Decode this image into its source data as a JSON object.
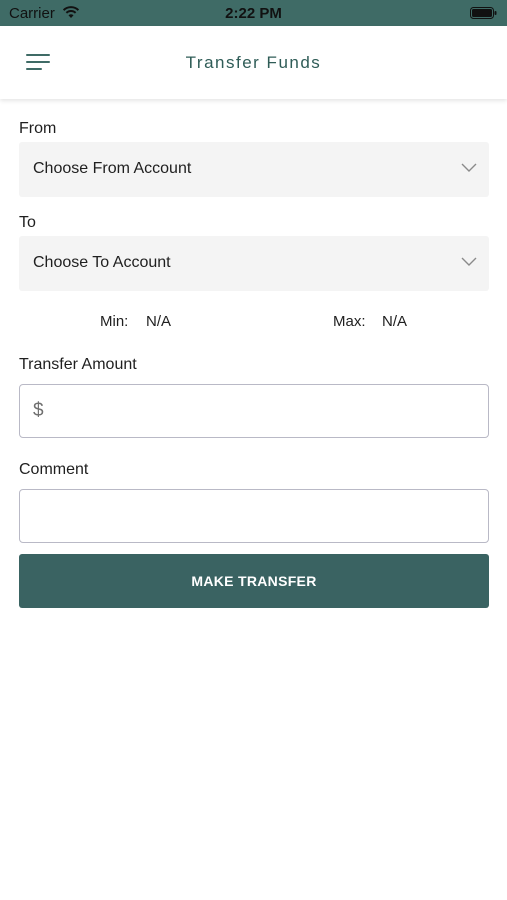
{
  "status_bar": {
    "carrier": "Carrier",
    "time": "2:22 PM"
  },
  "nav": {
    "title": "Transfer Funds"
  },
  "form": {
    "from_label": "From",
    "from_value": "Choose From Account",
    "to_label": "To",
    "to_value": "Choose To Account",
    "min_label": "Min:",
    "min_value": "N/A",
    "max_label": "Max:",
    "max_value": "N/A",
    "amount_label": "Transfer Amount",
    "currency_symbol": "$",
    "amount_value": "",
    "comment_label": "Comment",
    "comment_value": "",
    "submit_label": "MAKE TRANSFER"
  },
  "colors": {
    "primary": "#3a6362",
    "status_bar": "#3f6b66",
    "title": "#2f5c57"
  }
}
